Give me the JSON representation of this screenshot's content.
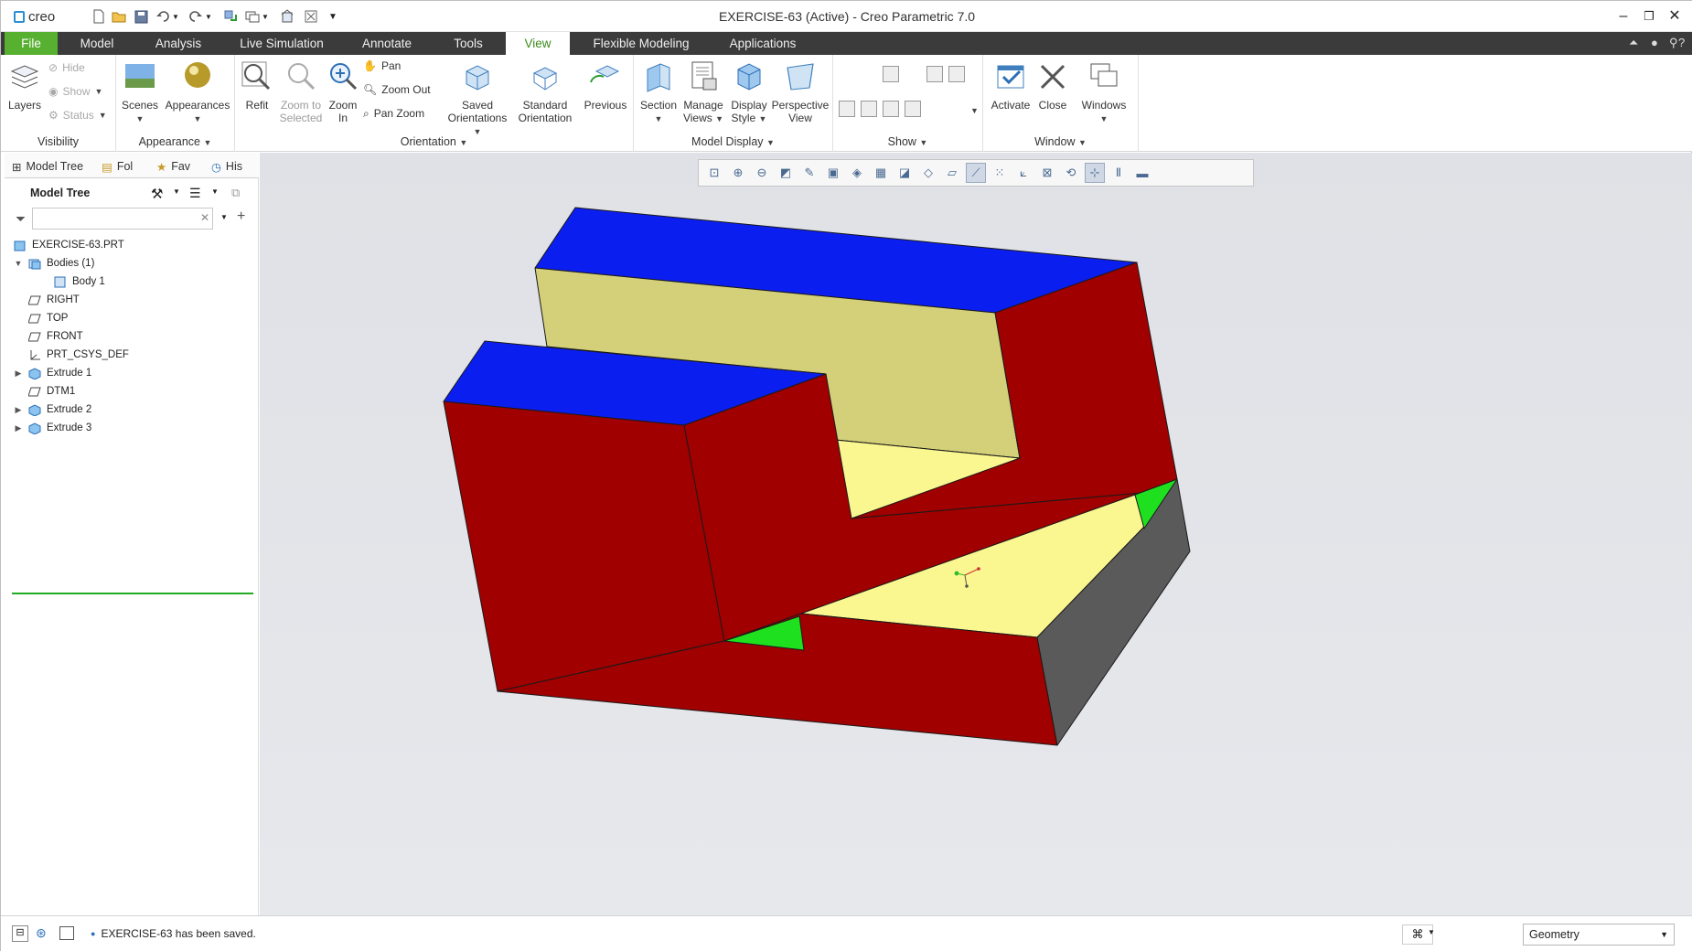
{
  "window": {
    "app_name": "creo",
    "title": "EXERCISE-63 (Active) - Creo Parametric 7.0"
  },
  "ribbon_tabs": [
    "File",
    "Model",
    "Analysis",
    "Live Simulation",
    "Annotate",
    "Tools",
    "View",
    "Flexible Modeling",
    "Applications"
  ],
  "active_tab": "View",
  "ribbon": {
    "visibility": {
      "label": "Visibility",
      "layers": "Layers",
      "hide": "Hide",
      "show": "Show",
      "status": "Status"
    },
    "appearance": {
      "label": "Appearance",
      "scenes": "Scenes",
      "appearances": "Appearances"
    },
    "orientation": {
      "label": "Orientation",
      "refit": "Refit",
      "zoom_selected_1": "Zoom to",
      "zoom_selected_2": "Selected",
      "zoom_in_1": "Zoom",
      "zoom_in_2": "In",
      "pan": "Pan",
      "zoom_out": "Zoom Out",
      "pan_zoom": "Pan Zoom",
      "saved_1": "Saved",
      "saved_2": "Orientations",
      "standard_1": "Standard",
      "standard_2": "Orientation",
      "previous": "Previous"
    },
    "model_display": {
      "label": "Model Display",
      "section": "Section",
      "manage_1": "Manage",
      "manage_2": "Views",
      "display_1": "Display",
      "display_2": "Style",
      "perspective_1": "Perspective",
      "perspective_2": "View"
    },
    "show": {
      "label": "Show"
    },
    "window_group": {
      "label": "Window",
      "activate": "Activate",
      "close": "Close",
      "windows": "Windows"
    }
  },
  "left_panel": {
    "tabs": [
      "Model Tree",
      "Folder Browser",
      "Favorites",
      "History"
    ],
    "tab_labels_shown": [
      "Model Tree",
      "Fol",
      "Fav",
      "His"
    ],
    "tree_title": "Model Tree",
    "search_placeholder": "",
    "tree": [
      {
        "label": "EXERCISE-63.PRT",
        "level": 0,
        "expander": "",
        "icon": "part-icon"
      },
      {
        "label": "Bodies (1)",
        "level": 1,
        "expander": "collapse",
        "icon": "bodies-icon"
      },
      {
        "label": "Body 1",
        "level": 2,
        "expander": "",
        "icon": "body-icon"
      },
      {
        "label": "RIGHT",
        "level": 1,
        "expander": "",
        "icon": "datum-plane-icon"
      },
      {
        "label": "TOP",
        "level": 1,
        "expander": "",
        "icon": "datum-plane-icon"
      },
      {
        "label": "FRONT",
        "level": 1,
        "expander": "",
        "icon": "datum-plane-icon"
      },
      {
        "label": "PRT_CSYS_DEF",
        "level": 1,
        "expander": "",
        "icon": "csys-icon"
      },
      {
        "label": "Extrude 1",
        "level": 1,
        "expander": "expand",
        "icon": "extrude-icon"
      },
      {
        "label": "DTM1",
        "level": 1,
        "expander": "",
        "icon": "datum-plane-icon"
      },
      {
        "label": "Extrude 2",
        "level": 1,
        "expander": "expand",
        "icon": "extrude-icon"
      },
      {
        "label": "Extrude 3",
        "level": 1,
        "expander": "expand",
        "icon": "extrude-icon"
      }
    ]
  },
  "graphics_toolbar": [
    "refit-icon",
    "zoom-in-icon",
    "zoom-out-icon",
    "repaint-icon",
    "spin-center-icon",
    "saved-orientations-icon",
    "display-style-icon",
    "view-manager-icon",
    "perspective-icon",
    "section-icon",
    "plane-display-icon",
    "axis-display-icon",
    "point-display-icon",
    "csys-display-icon",
    "annotation-display-icon",
    "spin-icon",
    "tag-icon",
    "pause-icon",
    "stop-icon"
  ],
  "model_colors": {
    "top_face": "#0b1ef0",
    "front_face": "#a00000",
    "side_face": "#5a5a5a",
    "inner_face": "#d4d07a",
    "floor_face": "#fbf790",
    "chamfer_face": "#1fe01f"
  },
  "status": {
    "message": "EXERCISE-63 has been saved.",
    "filter_value": "Geometry"
  }
}
